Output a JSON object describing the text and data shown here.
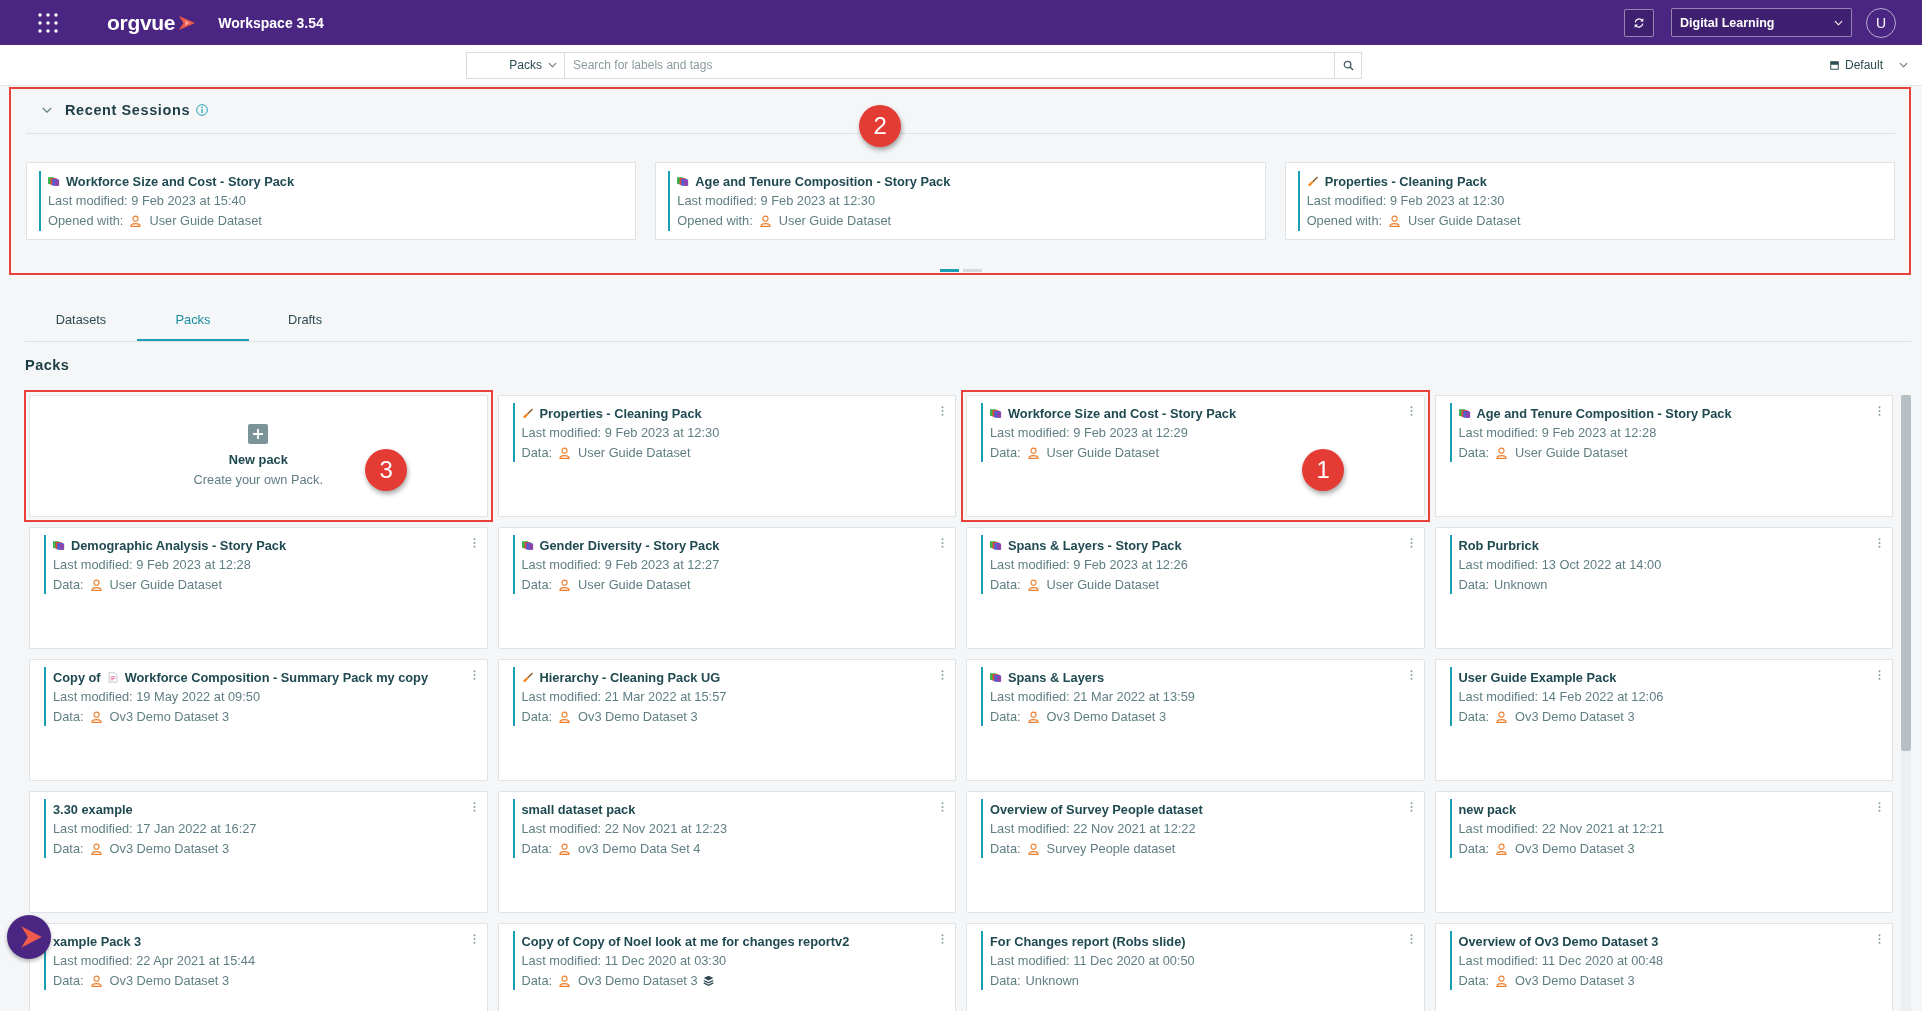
{
  "header": {
    "logo": "orgvue",
    "title": "Workspace 3.54",
    "workspace": "Digital Learning",
    "avatar": "U"
  },
  "search": {
    "scope": "Packs",
    "placeholder": "Search for labels and tags"
  },
  "view_menu": {
    "value": "Default"
  },
  "recent_sessions": {
    "title": "Recent Sessions",
    "expanded": true,
    "highlighted": true,
    "callout": "2",
    "cards": [
      {
        "kind": "story",
        "title": "Workforce Size and Cost - Story Pack",
        "modified": "Last modified: 9 Feb 2023 at 15:40",
        "opened_label": "Opened with:",
        "dataset": "User Guide Dataset"
      },
      {
        "kind": "story",
        "title": "Age and Tenure Composition - Story Pack",
        "modified": "Last modified: 9 Feb 2023 at 12:30",
        "opened_label": "Opened with:",
        "dataset": "User Guide Dataset"
      },
      {
        "kind": "cleaning",
        "title": "Properties - Cleaning Pack",
        "modified": "Last modified: 9 Feb 2023 at 12:30",
        "opened_label": "Opened with:",
        "dataset": "User Guide Dataset"
      }
    ],
    "pages": [
      {
        "selected": true
      },
      {
        "selected": false
      }
    ]
  },
  "tabs": [
    {
      "label": "Datasets",
      "selected": false
    },
    {
      "label": "Packs",
      "selected": true
    },
    {
      "label": "Drafts",
      "selected": false
    }
  ],
  "packs": {
    "title": "Packs",
    "new_pack": {
      "title": "New pack",
      "subtitle": "Create your own Pack.",
      "highlighted": true,
      "callout": "3"
    },
    "items": [
      {
        "kind": "cleaning",
        "title": "Properties - Cleaning Pack",
        "modified": "Last modified: 9 Feb 2023 at 12:30",
        "data_label": "Data:",
        "dataset": "User Guide Dataset",
        "dataset_icon": true,
        "layered": false,
        "highlighted": false
      },
      {
        "kind": "story",
        "title": "Workforce Size and Cost - Story Pack",
        "modified": "Last modified: 9 Feb 2023 at 12:29",
        "data_label": "Data:",
        "dataset": "User Guide Dataset",
        "dataset_icon": true,
        "layered": false,
        "highlighted": true,
        "callout": "1"
      },
      {
        "kind": "story",
        "title": "Age and Tenure Composition - Story Pack",
        "modified": "Last modified: 9 Feb 2023 at 12:28",
        "data_label": "Data:",
        "dataset": "User Guide Dataset",
        "dataset_icon": true,
        "layered": false,
        "highlighted": false
      },
      {
        "kind": "story",
        "title": "Demographic Analysis - Story Pack",
        "modified": "Last modified: 9 Feb 2023 at 12:28",
        "data_label": "Data:",
        "dataset": "User Guide Dataset",
        "dataset_icon": true,
        "layered": false,
        "highlighted": false
      },
      {
        "kind": "story",
        "title": "Gender Diversity - Story Pack",
        "modified": "Last modified: 9 Feb 2023 at 12:27",
        "data_label": "Data:",
        "dataset": "User Guide Dataset",
        "dataset_icon": true,
        "layered": false,
        "highlighted": false
      },
      {
        "kind": "story",
        "title": "Spans & Layers - Story Pack",
        "modified": "Last modified: 9 Feb 2023 at 12:26",
        "data_label": "Data:",
        "dataset": "User Guide Dataset",
        "dataset_icon": true,
        "layered": false,
        "highlighted": false
      },
      {
        "kind": "plain",
        "title": "Rob Purbrick",
        "modified": "Last modified: 13 Oct 2022 at 14:00",
        "data_label": "Data:",
        "dataset": "Unknown",
        "dataset_icon": false,
        "layered": false,
        "highlighted": false
      },
      {
        "prefix": "Copy of",
        "kind": "summary",
        "title": "Workforce Composition - Summary Pack my copy",
        "modified": "Last modified: 19 May 2022 at 09:50",
        "data_label": "Data:",
        "dataset": "Ov3 Demo Dataset 3",
        "dataset_icon": true,
        "layered": false,
        "highlighted": false
      },
      {
        "kind": "cleaning",
        "title": "Hierarchy - Cleaning Pack UG",
        "modified": "Last modified: 21 Mar 2022 at 15:57",
        "data_label": "Data:",
        "dataset": "Ov3 Demo Dataset 3",
        "dataset_icon": true,
        "layered": false,
        "highlighted": false
      },
      {
        "kind": "story",
        "title": "Spans & Layers",
        "modified": "Last modified: 21 Mar 2022 at 13:59",
        "data_label": "Data:",
        "dataset": "Ov3 Demo Dataset 3",
        "dataset_icon": true,
        "layered": false,
        "highlighted": false
      },
      {
        "kind": "plain",
        "title": "User Guide Example Pack",
        "modified": "Last modified: 14 Feb 2022 at 12:06",
        "data_label": "Data:",
        "dataset": "Ov3 Demo Dataset 3",
        "dataset_icon": true,
        "layered": false,
        "highlighted": false
      },
      {
        "kind": "plain",
        "title": "3.30 example",
        "modified": "Last modified: 17 Jan 2022 at 16:27",
        "data_label": "Data:",
        "dataset": "Ov3 Demo Dataset 3",
        "dataset_icon": true,
        "layered": false,
        "highlighted": false
      },
      {
        "kind": "plain",
        "title": "small dataset pack",
        "modified": "Last modified: 22 Nov 2021 at 12:23",
        "data_label": "Data:",
        "dataset": "ov3 Demo Data Set 4",
        "dataset_icon": true,
        "layered": false,
        "highlighted": false
      },
      {
        "kind": "plain",
        "title": "Overview of Survey People dataset",
        "modified": "Last modified: 22 Nov 2021 at 12:22",
        "data_label": "Data:",
        "dataset": "Survey People dataset",
        "dataset_icon": true,
        "layered": false,
        "highlighted": false
      },
      {
        "kind": "plain",
        "title": "new pack",
        "modified": "Last modified: 22 Nov 2021 at 12:21",
        "data_label": "Data:",
        "dataset": "Ov3 Demo Dataset 3",
        "dataset_icon": true,
        "layered": false,
        "highlighted": false
      },
      {
        "kind": "plain",
        "title": "xample Pack 3",
        "modified": "Last modified: 22 Apr 2021 at 15:44",
        "data_label": "Data:",
        "dataset": "Ov3 Demo Dataset 3",
        "dataset_icon": true,
        "layered": false,
        "highlighted": false
      },
      {
        "kind": "plain",
        "title": "Copy of Copy of Noel look at me for changes reportv2",
        "modified": "Last modified: 11 Dec 2020 at 03:30",
        "data_label": "Data:",
        "dataset": "Ov3 Demo Dataset 3",
        "dataset_icon": true,
        "layered": true,
        "highlighted": false
      },
      {
        "kind": "plain",
        "title": "For Changes report (Robs slide)",
        "modified": "Last modified: 11 Dec 2020 at 00:50",
        "data_label": "Data:",
        "dataset": "Unknown",
        "dataset_icon": false,
        "layered": false,
        "highlighted": false
      },
      {
        "kind": "plain",
        "title": "Overview of Ov3 Demo Dataset 3",
        "modified": "Last modified: 11 Dec 2020 at 00:48",
        "data_label": "Data:",
        "dataset": "Ov3 Demo Dataset 3",
        "dataset_icon": true,
        "layered": false,
        "highlighted": false
      }
    ]
  }
}
